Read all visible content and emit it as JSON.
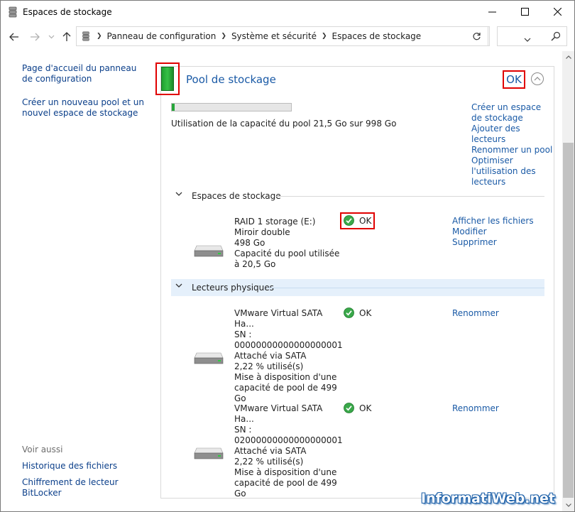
{
  "window": {
    "title": "Espaces de stockage"
  },
  "breadcrumb": [
    "Panneau de configuration",
    "Système et sécurité",
    "Espaces de stockage"
  ],
  "search": {
    "placeholder": ""
  },
  "sidebar": {
    "links": [
      "Page d'accueil du panneau de configuration",
      "Créer un nouveau pool et un nouvel espace de stockage"
    ],
    "see_also_heading": "Voir aussi",
    "see_also": [
      "Historique des fichiers",
      "Chiffrement de lecteur BitLocker"
    ]
  },
  "pool": {
    "title": "Pool de stockage",
    "status": "OK",
    "capacity_text": "Utilisation de la capacité du pool 21,5 Go sur 998 Go",
    "capacity_fraction": 0.0215,
    "actions": [
      "Créer un espace de stockage",
      "Ajouter des lecteurs",
      "Renommer un pool",
      "Optimiser l'utilisation des lecteurs"
    ]
  },
  "spaces": {
    "heading": "Espaces de stockage",
    "items": [
      {
        "name": "RAID 1 storage (E:)",
        "type": "Miroir double",
        "size": "498 Go",
        "usage": "Capacité du pool utilisée à 20,5 Go",
        "status": "OK",
        "actions": [
          "Afficher les fichiers",
          "Modifier",
          "Supprimer"
        ]
      }
    ]
  },
  "physical": {
    "heading": "Lecteurs physiques",
    "items": [
      {
        "name": "VMware Virtual SATA Ha...",
        "sn_label": "SN :",
        "sn": "00000000000000000001",
        "connection": "Attaché via SATA",
        "usage": "2,22 % utilisé(s)",
        "provides": "Mise à disposition d'une capacité de pool de 499 Go",
        "status": "OK",
        "action": "Renommer"
      },
      {
        "name": "VMware Virtual SATA Ha...",
        "sn_label": "SN :",
        "sn": "02000000000000000001",
        "connection": "Attaché via SATA",
        "usage": "2,22 % utilisé(s)",
        "provides": "Mise à disposition d'une capacité de pool de 499 Go",
        "status": "OK",
        "action": "Renommer"
      }
    ]
  },
  "watermark": "InformatiWeb.net",
  "colors": {
    "link": "#1a5aa6",
    "accent_green": "#26a63a",
    "highlight_red": "#e00000"
  }
}
